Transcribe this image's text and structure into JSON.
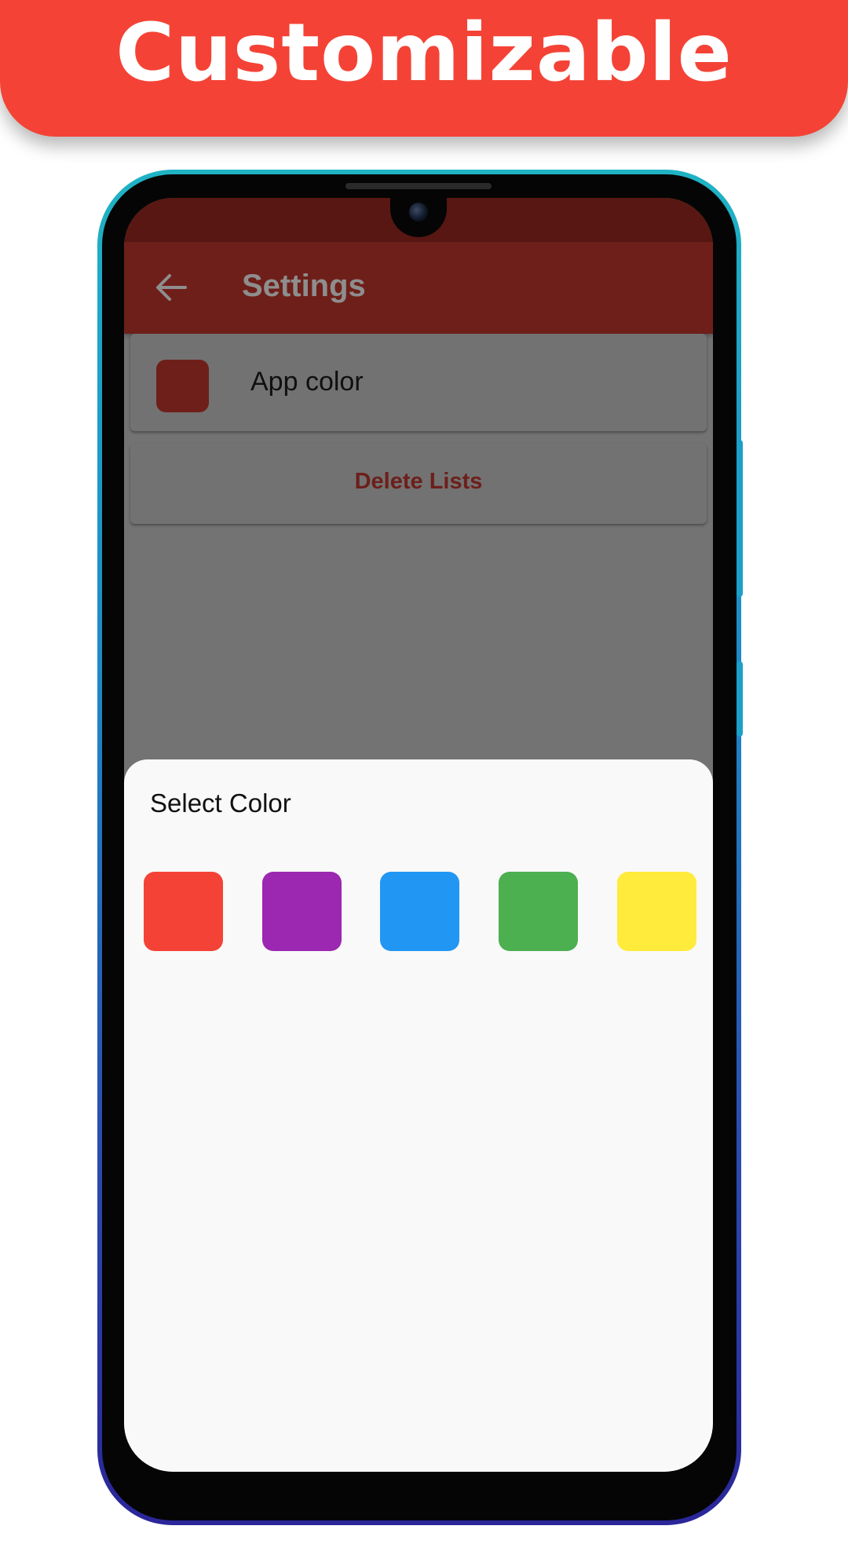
{
  "banner": {
    "title": "Customizable"
  },
  "app_bar": {
    "title": "Settings",
    "back_icon": "arrow-back-icon"
  },
  "settings": {
    "app_color": {
      "label": "App color",
      "current_color": "#6f1f1a"
    },
    "delete_lists": {
      "label": "Delete Lists"
    }
  },
  "color_sheet": {
    "title": "Select Color",
    "options": [
      {
        "name": "red",
        "color": "#f44336"
      },
      {
        "name": "purple",
        "color": "#9c27b0"
      },
      {
        "name": "blue",
        "color": "#2196f3"
      },
      {
        "name": "green",
        "color": "#4caf50"
      },
      {
        "name": "yellow",
        "color": "#ffeb3b"
      }
    ]
  }
}
